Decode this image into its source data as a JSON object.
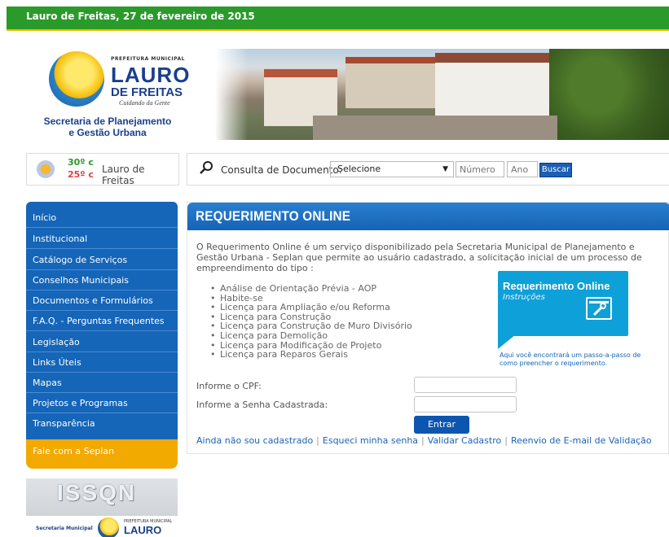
{
  "topbar": {
    "date": "Lauro de Freitas, 27 de fevereiro de 2015"
  },
  "logo": {
    "small": "PREFEITURA MUNICIPAL",
    "lauro": "LAURO",
    "freitas": "DE FREITAS",
    "tagline": "Cuidando da Gente",
    "dept_line1": "Secretaria de Planejamento",
    "dept_line2": "e Gestão Urbana"
  },
  "weather": {
    "high": "30º c",
    "low": "25º c",
    "city": "Lauro de Freitas"
  },
  "search": {
    "label": "Consulta de Documento:",
    "select_value": "Selecione",
    "numero_placeholder": "Número",
    "ano_placeholder": "Ano",
    "button": "Buscar"
  },
  "sidebar": {
    "items": [
      {
        "label": "Início"
      },
      {
        "label": "Institucional"
      },
      {
        "label": "Catálogo de Serviços"
      },
      {
        "label": "Conselhos Municipais"
      },
      {
        "label": "Documentos e Formulários"
      },
      {
        "label": "F.A.Q. - Perguntas Frequentes"
      },
      {
        "label": "Legislação"
      },
      {
        "label": "Links Úteis"
      },
      {
        "label": "Mapas"
      },
      {
        "label": "Projetos e Programas"
      },
      {
        "label": "Transparência"
      }
    ],
    "fale": "Fale com a Seplan",
    "banner": {
      "title": "ISSQN",
      "dept": "Secretaria Municipal",
      "small": "PREFEITURA MUNICIPAL",
      "lauro": "LAURO"
    }
  },
  "main": {
    "title": "REQUERIMENTO ONLINE",
    "intro": "O Requerimento Online é um serviço disponibilizado pela Secretaria Municipal de Planejamento e Gestão Urbana - Seplan que permite ao usuário cadastrado, a solicitação inicial de um processo de empreendimento do tipo :",
    "types": [
      "Análise de Orientação Prévia - AOP",
      "Habite-se",
      "Licença para Ampliação e/ou Reforma",
      "Licença para Construção",
      "Licença para Construção de Muro Divisório",
      "Licença para Demolição",
      "Licença para Modificação de Projeto",
      "Licença para Reparos Gerais"
    ],
    "promo": {
      "title": "Requerimento Online",
      "subtitle": "Instruções",
      "caption": "Aqui você encontrará um passo-a-passo de como preencher o requerimento."
    },
    "form": {
      "cpf_label": "Informe o CPF:",
      "senha_label": "Informe a Senha Cadastrada:",
      "submit": "Entrar"
    },
    "links": [
      "Ainda não sou cadastrado",
      "Esqueci minha senha",
      "Validar Cadastro",
      "Reenvio de E-mail de Validação"
    ]
  },
  "colors": {
    "green": "#2a9a2a",
    "blue": "#1565b8",
    "orange": "#f2a900",
    "cyan": "#0ea0d8"
  },
  "icons": [
    "search-icon",
    "weather-icon",
    "chevron-down-icon",
    "tools-icon"
  ]
}
